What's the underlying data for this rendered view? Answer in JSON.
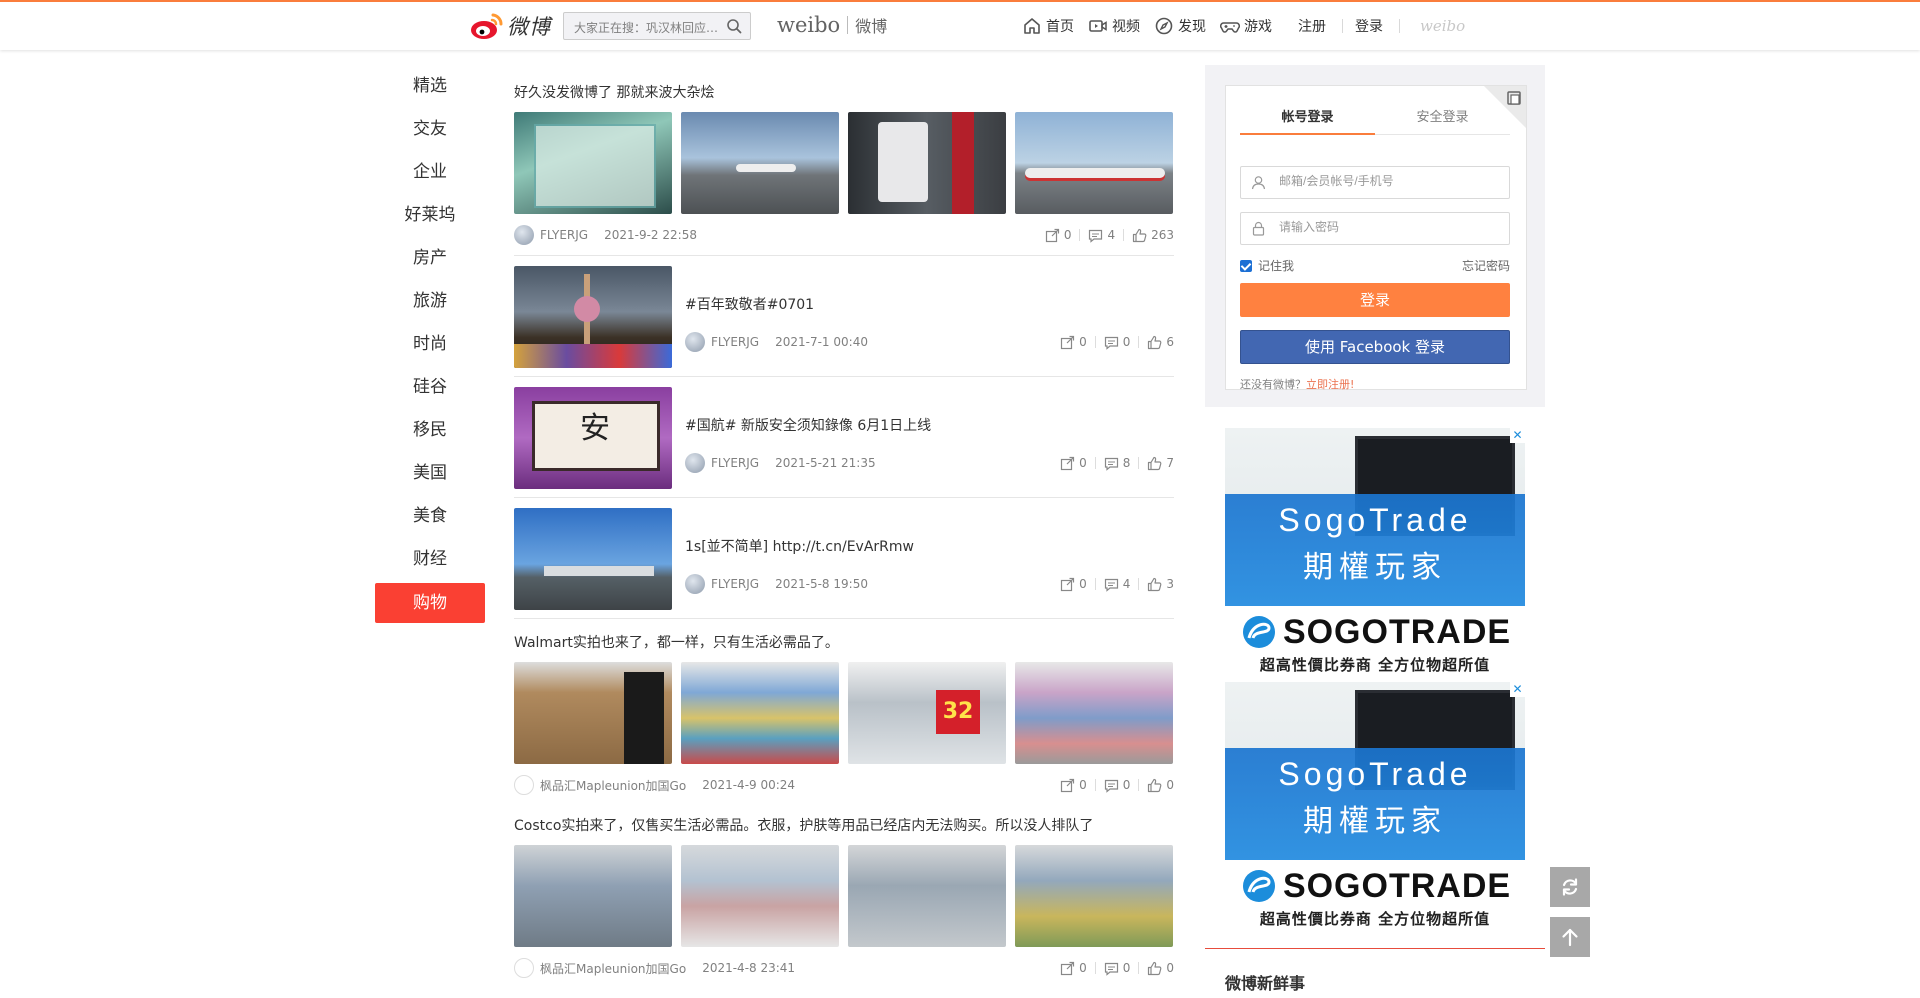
{
  "header": {
    "logo_text": "微博",
    "search_placeholder": "大家正在搜：巩汉林回应…",
    "brand_en": "weibo",
    "brand_cn": "微博",
    "nav": [
      {
        "label": "首页",
        "icon": "home-icon"
      },
      {
        "label": "视频",
        "icon": "video-icon"
      },
      {
        "label": "发现",
        "icon": "discover-icon"
      },
      {
        "label": "游戏",
        "icon": "game-icon"
      }
    ],
    "register": "注册",
    "login": "登录",
    "weibo_mark": "weibo",
    "accent_color": "#fa7d3c"
  },
  "categories": {
    "items": [
      "精选",
      "交友",
      "企业",
      "好莱坞",
      "房产",
      "旅游",
      "时尚",
      "硅谷",
      "移民",
      "美国",
      "美食",
      "财经"
    ],
    "active": "购物",
    "active_color": "#fa4033"
  },
  "feed": {
    "posts": [
      {
        "text": "好久没发微博了 那就来波大杂烩",
        "author": "FLYERJG",
        "time": "2021-9-2 22:58",
        "reposts": "0",
        "comments": "4",
        "likes": "263"
      },
      {
        "text": "#百年致敬者#0701",
        "author": "FLYERJG",
        "time": "2021-7-1 00:40",
        "reposts": "0",
        "comments": "0",
        "likes": "6"
      },
      {
        "text": "#国航# 新版安全须知錄像 6月1日上线",
        "author": "FLYERJG",
        "time": "2021-5-21 21:35",
        "reposts": "0",
        "comments": "8",
        "likes": "7"
      },
      {
        "text": "1s[並不简单] http://t.cn/EvArRmw",
        "author": "FLYERJG",
        "time": "2021-5-8 19:50",
        "reposts": "0",
        "comments": "4",
        "likes": "3"
      },
      {
        "text": "Walmart实拍也来了，都一样，只有生活必需品了。",
        "author": "枫品汇Mapleunion加国Go",
        "time": "2021-4-9 00:24",
        "reposts": "0",
        "comments": "0",
        "likes": "0"
      },
      {
        "text": "Costco实拍来了，仅售买生活必需品。衣服，护肤等用品已经店内无法购买。所以没人排队了",
        "author": "枫品汇Mapleunion加国Go",
        "time": "2021-4-8 23:41",
        "reposts": "0",
        "comments": "0",
        "likes": "0"
      }
    ]
  },
  "login": {
    "tab_account": "帐号登录",
    "tab_secure": "安全登录",
    "username_placeholder": "邮箱/会员帐号/手机号",
    "password_placeholder": "请输入密码",
    "remember": "记住我",
    "forgot": "忘记密码",
    "login_button": "登录",
    "facebook_button": "使用 Facebook 登录",
    "no_account": "还没有微博？",
    "register_link": "立即注册!"
  },
  "ads": [
    {
      "line1": "SogoTrade",
      "line2": "期權玩家",
      "logo": "SOGOTRADE",
      "slogan": "超高性價比券商  全方位物超所值",
      "close": "✕"
    },
    {
      "line1": "SogoTrade",
      "line2": "期權玩家",
      "logo": "SOGOTRADE",
      "slogan": "超高性價比券商  全方位物超所值",
      "close": "✕"
    }
  ],
  "news_title": "微博新鲜事"
}
